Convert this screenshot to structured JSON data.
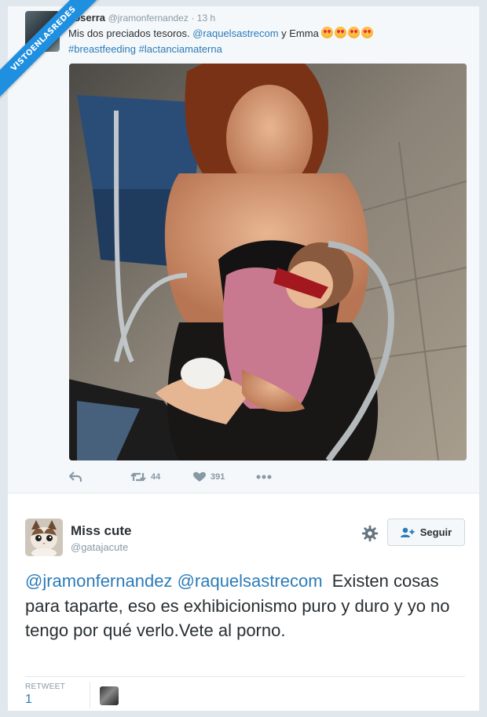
{
  "watermark": {
    "text": "VISTOENLASREDES"
  },
  "tweet": {
    "author_name": "Joserra",
    "author_handle": "@jramonfernandez",
    "time": "· 13 h",
    "text_before": "Mis dos preciados tesoros. ",
    "mention": "@raquelsastrecom",
    "text_after": " y Emma ",
    "emoji_name": "heart-eyes-emoji",
    "hashtags": "#breastfeeding #lactanciamaterna",
    "retweets": "44",
    "likes": "391"
  },
  "reply": {
    "author_name": "Miss cute",
    "author_handle": "@gatajacute",
    "follow_label": "Seguir",
    "mention1": "@jramonfernandez",
    "mention2": "@raquelsastrecom",
    "text": "  Existen cosas para taparte, eso es exhibicionismo puro y duro y yo no tengo por qué verlo.Vete al porno.",
    "retweet_label": "RETWEET",
    "retweet_count": "1"
  },
  "colors": {
    "link": "#2b7bb9",
    "muted": "#8899a6",
    "ribbon": "#1f8fe0",
    "background": "#e1e8ed"
  }
}
